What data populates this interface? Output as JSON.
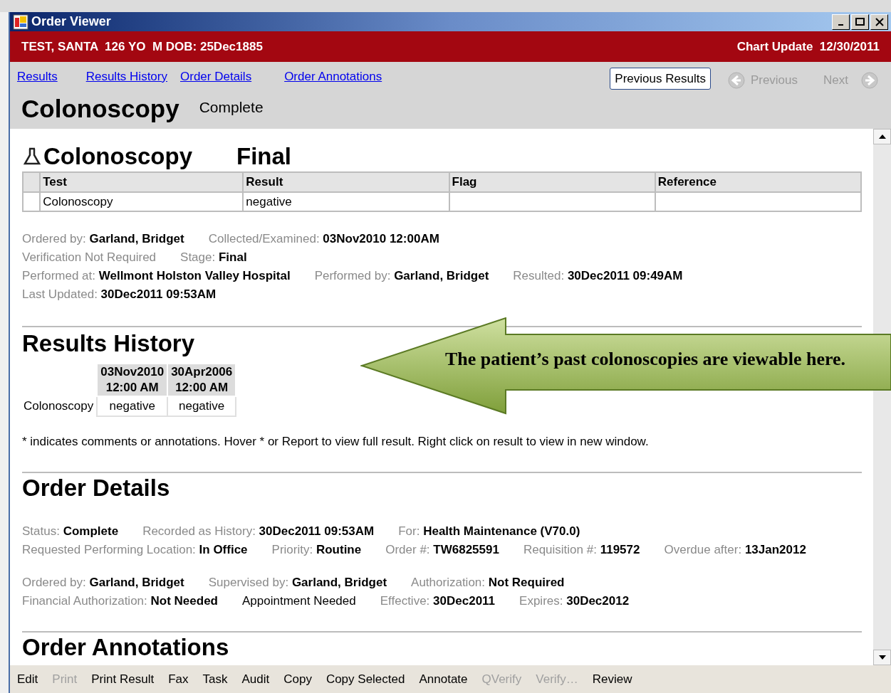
{
  "window": {
    "title": "Order Viewer"
  },
  "patient_bar": {
    "patient": "TEST, SANTA  126 YO  M DOB: 25Dec1885",
    "chart_update": "Chart Update  12/30/2011"
  },
  "nav_links": [
    "Results",
    "Results History",
    "Order Details",
    "Order Annotations"
  ],
  "nav_buttons": [
    {
      "label": "Previous Results",
      "kind": "button",
      "disabled": false
    },
    {
      "label": "Previous",
      "kind": "back",
      "disabled": true
    },
    {
      "label": "Next",
      "kind": "forward",
      "disabled": true
    }
  ],
  "header": {
    "title": "Colonoscopy",
    "status": "Complete"
  },
  "results": {
    "title": "Colonoscopy",
    "stage": "Final",
    "columns": [
      "Test",
      "Result",
      "Flag",
      "Reference"
    ],
    "rows": [
      [
        "Colonoscopy",
        "negative",
        "",
        ""
      ]
    ],
    "fields": [
      [
        {
          "kind": "pair",
          "label": "Ordered by:",
          "value": "Garland, Bridget"
        },
        {
          "kind": "pair",
          "label": "Collected/Examined:",
          "value": "03Nov2010 12:00AM"
        }
      ],
      [
        {
          "kind": "muted",
          "label": "Verification Not Required"
        },
        {
          "kind": "pair",
          "label": "Stage:",
          "value": "Final"
        }
      ],
      [
        {
          "kind": "pair",
          "label": "Performed at:",
          "value": "Wellmont Holston Valley Hospital"
        },
        {
          "kind": "pair",
          "label": "Performed by:",
          "value": "Garland, Bridget"
        },
        {
          "kind": "pair",
          "label": "Resulted:",
          "value": "30Dec2011 09:49AM"
        }
      ],
      [
        {
          "kind": "pair",
          "label": "Last Updated:",
          "value": "30Dec2011 09:53AM"
        }
      ]
    ]
  },
  "results_history": {
    "title": "Results History",
    "dates": [
      [
        "03Nov2010",
        "12:00 AM"
      ],
      [
        "30Apr2006",
        "12:00 AM"
      ]
    ],
    "rows": [
      {
        "test": "Colonoscopy",
        "values": [
          "negative",
          "negative"
        ]
      }
    ],
    "note": "* indicates comments or annotations. Hover * or Report to view full result. Right click on result to view in new window."
  },
  "order_details": {
    "title": "Order Details",
    "groups": [
      [
        [
          {
            "kind": "pair",
            "label": "Status:",
            "value": "Complete"
          },
          {
            "kind": "pair",
            "label": "Recorded as History:",
            "value": "30Dec2011 09:53AM"
          },
          {
            "kind": "pair",
            "label": "For:",
            "value": "Health Maintenance (V70.0)"
          }
        ],
        [
          {
            "kind": "pair",
            "label": "Requested Performing Location:",
            "value": "In Office"
          },
          {
            "kind": "pair",
            "label": "Priority:",
            "value": "Routine"
          },
          {
            "kind": "pair",
            "label": "Order #:",
            "value": "TW6825591"
          },
          {
            "kind": "pair",
            "label": "Requisition #:",
            "value": "119572"
          },
          {
            "kind": "pair",
            "label": "Overdue after:",
            "value": "13Jan2012"
          }
        ]
      ],
      [
        [
          {
            "kind": "pair",
            "label": "Ordered by:",
            "value": "Garland, Bridget"
          },
          {
            "kind": "pair",
            "label": "Supervised by:",
            "value": "Garland, Bridget"
          },
          {
            "kind": "pair",
            "label": "Authorization:",
            "value": "Not Required"
          }
        ],
        [
          {
            "kind": "pair",
            "label": "Financial Authorization:",
            "value": "Not Needed"
          },
          {
            "kind": "plain",
            "label": "Appointment Needed"
          },
          {
            "kind": "pair",
            "label": "Effective:",
            "value": "30Dec2011"
          },
          {
            "kind": "pair",
            "label": "Expires:",
            "value": "30Dec2012"
          }
        ]
      ]
    ]
  },
  "order_annotations": {
    "title": "Order Annotations"
  },
  "toolbar": [
    {
      "label": "Edit",
      "disabled": false
    },
    {
      "label": "Print",
      "disabled": true
    },
    {
      "label": "Print Result",
      "disabled": false
    },
    {
      "label": "Fax",
      "disabled": false
    },
    {
      "label": "Task",
      "disabled": false
    },
    {
      "label": "Audit",
      "disabled": false
    },
    {
      "label": "Copy",
      "disabled": false
    },
    {
      "label": "Copy Selected",
      "disabled": false
    },
    {
      "label": "Annotate",
      "disabled": false
    },
    {
      "label": "QVerify",
      "disabled": true
    },
    {
      "label": "Verify…",
      "disabled": true
    },
    {
      "label": "Review",
      "disabled": false
    }
  ],
  "callout": {
    "text": "The patient’s past colonoscopies are viewable here."
  }
}
